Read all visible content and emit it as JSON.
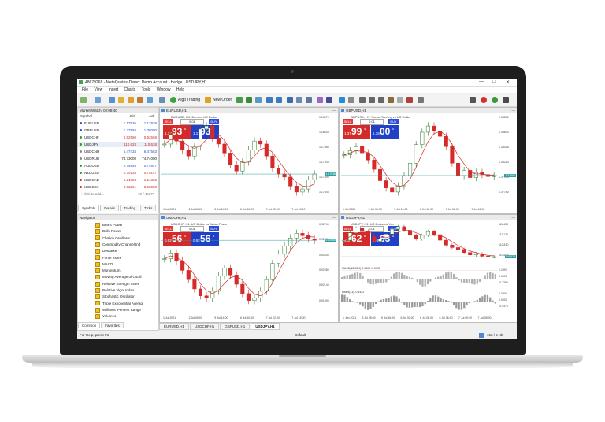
{
  "window": {
    "title": "48679268 - MetaQuotes-Demo: Demo Account - Hedge - USDJPY,H1",
    "controls": [
      "—",
      "□",
      "✕"
    ]
  },
  "menu": [
    "File",
    "View",
    "Insert",
    "Charts",
    "Tools",
    "Window",
    "Help"
  ],
  "toolbar": {
    "algo_trading": "Algo Trading",
    "new_order": "New Order"
  },
  "market_watch": {
    "title": "Market Watch: 02:08:40",
    "headers": {
      "symbol": "Symbol",
      "bid": "Bid",
      "ask": "Ask"
    },
    "rows": [
      {
        "symbol": "EURUSD",
        "bid": "1.17936",
        "ask": "1.17938",
        "color": "#2a4fd6",
        "dot": "#2a4fd6"
      },
      {
        "symbol": "GBPUSD",
        "bid": "1.37994",
        "ask": "1.38000",
        "color": "#2a4fd6",
        "dot": "#2a4fd6"
      },
      {
        "symbol": "USDCHF",
        "bid": "0.92560",
        "ask": "0.92569",
        "color": "#d42a2a",
        "dot": "#2aa02a"
      },
      {
        "symbol": "USDJPY",
        "bid": "110.628",
        "ask": "110.638",
        "color": "#d42a2a",
        "dot": "#2aa02a",
        "highlight": true
      },
      {
        "symbol": "USDCNH",
        "bid": "6.47434",
        "ask": "6.47583",
        "color": "#2a4fd6",
        "dot": "#888888"
      },
      {
        "symbol": "USDRUB",
        "bid": "74.73000",
        "ask": "74.74000",
        "color": "#222222",
        "dot": "#888888"
      },
      {
        "symbol": "AUDUSD",
        "bid": "0.74855",
        "ask": "0.74847",
        "color": "#2a4fd6",
        "dot": "#2aa02a"
      },
      {
        "symbol": "NZDUSD",
        "bid": "0.70138",
        "ask": "0.70147",
        "color": "#d42a2a",
        "dot": "#2aa02a"
      },
      {
        "symbol": "USDCAD",
        "bid": "1.24823",
        "ask": "1.24832",
        "color": "#d42a2a",
        "dot": "#d42a2a"
      },
      {
        "symbol": "USDSEK",
        "bid": "8.63291",
        "ask": "8.63558",
        "color": "#d42a2a",
        "dot": "#d42a2a"
      }
    ],
    "add_hint": "+ click to add...",
    "count": "10 / 4687?",
    "tabs": [
      "Symbols",
      "Details",
      "Trading",
      "Ticks"
    ]
  },
  "navigator": {
    "title": "Navigator",
    "items": [
      "Bears Power",
      "Bulls Power",
      "Chaikin Oscillator",
      "Commodity Channel Ind",
      "DeMarker",
      "Force Index",
      "MACD",
      "Momentum",
      "Moving Average of Oscill",
      "Relative Strength Index",
      "Relative Vigor Index",
      "Stochastic Oscillator",
      "Triple Exponential Averag",
      "Williams' Percent Range",
      "Volumes"
    ],
    "tabs": [
      "Common",
      "Favorites"
    ]
  },
  "charts": [
    {
      "window_title": "EURUSD,H1",
      "subtitle": "EURUSD, H1: Euro vs US Dollar",
      "lot": "0.01",
      "sell_small": "1.17",
      "sell_big": "93",
      "sell_sup": "6",
      "buy_small": "1.17",
      "buy_big": "93",
      "buy_sup": "7",
      "axis": [
        "1.18070",
        "1.18035",
        "1.17980",
        "1.17935",
        "1.17890",
        "1.17845"
      ],
      "xaxis": [
        "1 Jul 2021",
        "2 Jul 06:00",
        "5 Jul 14:00",
        "6 Jul 10:00",
        "7 Jul 02:00",
        "7 Jul 18:00"
      ],
      "last_price": "1.17936",
      "data": [
        1.18,
        1.1803,
        1.1801,
        1.1798,
        1.1796,
        1.1799,
        1.1805,
        1.1806,
        1.1802,
        1.18,
        1.1797,
        1.1793,
        1.1791,
        1.1794,
        1.1798,
        1.1801,
        1.18,
        1.1796,
        1.1792,
        1.179,
        1.1789,
        1.1786,
        1.1784,
        1.1785,
        1.1788,
        1.179
      ]
    },
    {
      "window_title": "GBPUSD,H1",
      "subtitle": "GBPUSD, H1: Pound Sterling vs US Dollar",
      "lot": "0.01",
      "sell_small": "1.37",
      "sell_big": "99",
      "sell_sup": "4",
      "buy_small": "1.38",
      "buy_big": "00",
      "buy_sup": "0",
      "axis": [
        "1.38850",
        "1.38640",
        "1.38425",
        "1.38210",
        "1.37994",
        "1.37780"
      ],
      "xaxis": [
        "1 Jul 2021",
        "2 Jul 06:00",
        "5 Jul 14:00",
        "6 Jul 10:00",
        "7 Jul 02:00",
        "7 Jul 18:00"
      ],
      "last_price": "1.37994",
      "data": [
        1.382,
        1.3824,
        1.3828,
        1.3822,
        1.3815,
        1.3806,
        1.3795,
        1.3788,
        1.3784,
        1.379,
        1.38,
        1.3812,
        1.383,
        1.3842,
        1.3848,
        1.3843,
        1.3838,
        1.3828,
        1.3812,
        1.38,
        1.3805,
        1.3798,
        1.3803,
        1.3801,
        1.3799,
        1.38
      ]
    },
    {
      "window_title": "USDCHF,H1",
      "subtitle": "USDCHF, H1: US Dollar vs Swiss Franc",
      "lot": "0.01",
      "sell_small": "0.92",
      "sell_big": "56",
      "sell_sup": "0",
      "buy_small": "0.92",
      "buy_big": "56",
      "buy_sup": "9",
      "axis": [
        "0.92740",
        "0.92580",
        "0.92430",
        "0.92280",
        "0.92140",
        "0.91990"
      ],
      "xaxis": [
        "1 Jul 2021",
        "2 Jul 06:00",
        "5 Jul 14:00",
        "6 Jul 10:00",
        "7 Jul 02:00",
        "7 Jul 18:00"
      ],
      "last_price": "0.92560",
      "data": [
        0.924,
        0.9245,
        0.9238,
        0.923,
        0.9222,
        0.9214,
        0.9208,
        0.9206,
        0.9212,
        0.9225,
        0.9232,
        0.9226,
        0.9218,
        0.921,
        0.9204,
        0.9206,
        0.9212,
        0.9222,
        0.9236,
        0.9244,
        0.9251,
        0.9258,
        0.9262,
        0.926,
        0.9257,
        0.9256
      ]
    },
    {
      "window_title": "USDJPY,H1",
      "subtitle": "USDJPY, H1: US Dollar vs Yen",
      "lot": "0.01",
      "sell_small": "110",
      "sell_big": "62",
      "sell_sup": "8",
      "buy_small": "110",
      "buy_big": "63",
      "buy_sup": "8",
      "axis": [
        "111.430",
        "111.120",
        "110.810",
        "110.628"
      ],
      "macd_label": "MACD(12,26,9) 0.0103 -0.0105",
      "macd_axis": [
        "0.2397",
        "0.0000",
        "-0.2380"
      ],
      "bears_label": "Bears(13) -0.1442",
      "bears_axis": [
        "0.3200",
        "0.0000",
        "-0.4376"
      ],
      "xaxis": [
        "1 Jun 2021",
        "5 Jul 08:00",
        "5 Jul 16:00",
        "6 Jul 00:00",
        "6 Jul 08:00",
        "6 Jul 16:00",
        "7 Jul 00:00",
        "7 Jul 08:00"
      ],
      "last_price": "110.628",
      "data": [
        110.9,
        111.02,
        111.1,
        111.05,
        110.96,
        110.88,
        110.92,
        111.0,
        111.08,
        111.12,
        111.06,
        110.98,
        110.92,
        110.98,
        111.04,
        110.99,
        110.9,
        110.82,
        110.78,
        110.75,
        110.7,
        110.66,
        110.68,
        110.64,
        110.63,
        110.63
      ]
    }
  ],
  "bottom_tabs": [
    "EURUSD,H1",
    "USDCHF,H1",
    "GBPUSD,H1",
    "USDJPY,H1"
  ],
  "status": {
    "help": "For Help, press F1",
    "profile": "Default",
    "traffic": "153 / 5 Kb"
  },
  "colors": {
    "bull": "#2a7a2a",
    "bear": "#d42a2a",
    "ma": "#d42a2a",
    "price_line": "#2aa0a0"
  }
}
